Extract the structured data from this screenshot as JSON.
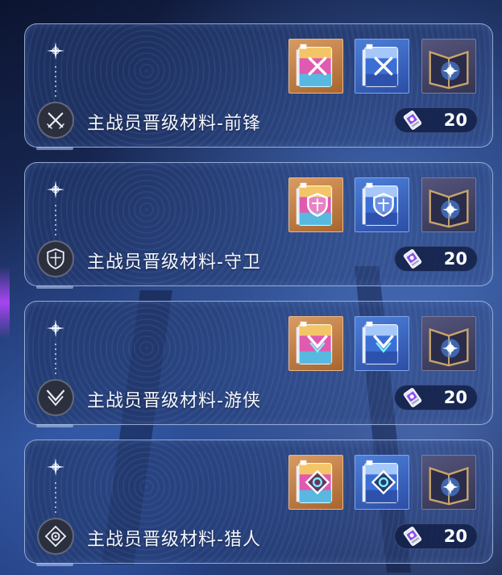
{
  "materials": [
    {
      "title": "主战员晋级材料-前锋",
      "role_icon": "crossed-swords-icon",
      "cost": "20",
      "items": [
        {
          "name": "vanguard-manual-gold-icon",
          "rarity": "gold",
          "emblem": "crossed-swords"
        },
        {
          "name": "vanguard-manual-blue-icon",
          "rarity": "blue",
          "emblem": "crossed-swords"
        },
        {
          "name": "star-tome-icon",
          "rarity": "purple",
          "emblem": "star"
        }
      ]
    },
    {
      "title": "主战员晋级材料-守卫",
      "role_icon": "shield-icon",
      "cost": "20",
      "items": [
        {
          "name": "guard-manual-gold-icon",
          "rarity": "gold",
          "emblem": "shield"
        },
        {
          "name": "guard-manual-blue-icon",
          "rarity": "blue",
          "emblem": "shield"
        },
        {
          "name": "star-tome-icon",
          "rarity": "purple",
          "emblem": "star"
        }
      ]
    },
    {
      "title": "主战员晋级材料-游侠",
      "role_icon": "ranger-blades-icon",
      "cost": "20",
      "items": [
        {
          "name": "ranger-manual-gold-icon",
          "rarity": "gold",
          "emblem": "chevron"
        },
        {
          "name": "ranger-manual-blue-icon",
          "rarity": "blue",
          "emblem": "chevron"
        },
        {
          "name": "star-tome-icon",
          "rarity": "purple",
          "emblem": "star"
        }
      ]
    },
    {
      "title": "主战员晋级材料-猎人",
      "role_icon": "target-reticle-icon",
      "cost": "20",
      "items": [
        {
          "name": "hunter-manual-gold-icon",
          "rarity": "gold",
          "emblem": "eye"
        },
        {
          "name": "hunter-manual-blue-icon",
          "rarity": "blue",
          "emblem": "eye"
        },
        {
          "name": "star-tome-icon",
          "rarity": "purple",
          "emblem": "star"
        }
      ]
    }
  ],
  "currency_icon": "ticket-icon",
  "colors": {
    "gold_frame": "#d99b62",
    "blue_frame": "#4c7fd8",
    "purple_frame": "#55557d",
    "card_border": "#b9cdf0"
  }
}
